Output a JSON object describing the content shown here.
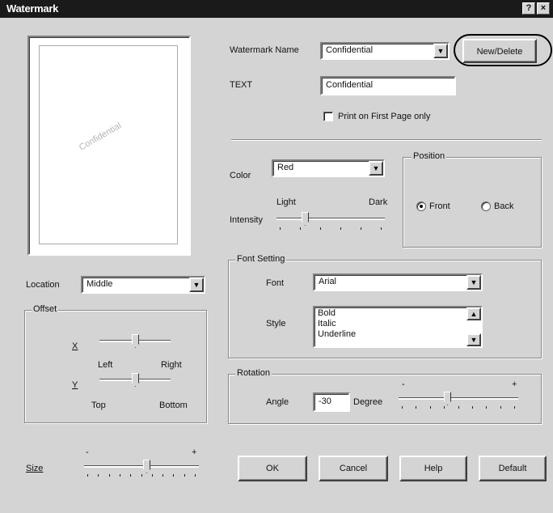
{
  "window": {
    "title": "Watermark",
    "help_glyph": "?",
    "close_glyph": "×"
  },
  "preview": {
    "watermark_text": "Confidential"
  },
  "watermark_name": {
    "label": "Watermark Name",
    "value": "Confidential",
    "new_delete_label": "New/Delete"
  },
  "text": {
    "label": "TEXT",
    "value": "Confidential"
  },
  "print_first_page": {
    "label": "Print on First Page only",
    "checked": false
  },
  "color": {
    "label": "Color",
    "value": "Red"
  },
  "intensity": {
    "label": "Intensity",
    "light_label": "Light",
    "dark_label": "Dark",
    "level": 0.25
  },
  "position": {
    "legend": "Position",
    "front_label": "Front",
    "back_label": "Back",
    "selected": "Front"
  },
  "font_setting": {
    "legend": "Font Setting",
    "font_label": "Font",
    "font_value": "Arial",
    "style_label": "Style",
    "style_options": [
      "Bold",
      "Italic",
      "Underline"
    ]
  },
  "rotation": {
    "legend": "Rotation",
    "angle_label": "Angle",
    "angle_value": "-30",
    "degree_label": "Degree",
    "minus": "-",
    "plus": "+",
    "level": 0.4
  },
  "location": {
    "label": "Location",
    "value": "Middle"
  },
  "offset": {
    "legend": "Offset",
    "x_label": "X",
    "left_label": "Left",
    "right_label": "Right",
    "x_level": 0.5,
    "y_label": "Y",
    "top_label": "Top",
    "bottom_label": "Bottom",
    "y_level": 0.5
  },
  "size": {
    "label": "Size",
    "minus": "-",
    "plus": "+",
    "level": 0.55
  },
  "buttons": {
    "ok": "OK",
    "cancel": "Cancel",
    "help": "Help",
    "default": "Default"
  },
  "icons": {
    "dropdown": "triangle-down",
    "scroll_up": "triangle-up",
    "scroll_down": "triangle-down"
  }
}
